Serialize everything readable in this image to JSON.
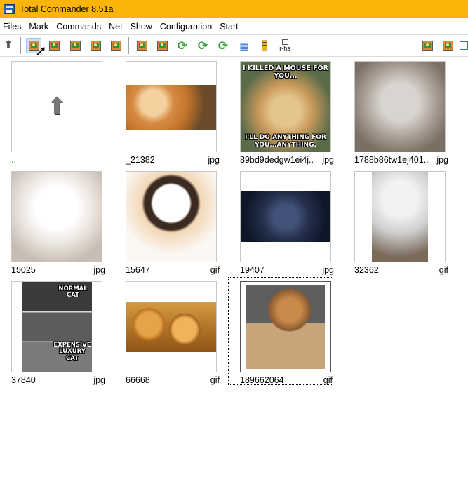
{
  "window": {
    "title": "Total Commander 8.51a"
  },
  "menu": [
    "Files",
    "Mark",
    "Commands",
    "Net",
    "Show",
    "Configuration",
    "Start"
  ],
  "toolbar": {
    "rhs_label": "r-hs"
  },
  "files": [
    {
      "name": "..",
      "ext": "",
      "kind": "parent"
    },
    {
      "name": "_21382",
      "ext": "jpg",
      "kind": "image"
    },
    {
      "name": "89bd9dedgw1ei4j..",
      "ext": "jpg",
      "kind": "meme",
      "top_text": "I KILLED A MOUSE FOR YOU...",
      "bottom_text": "I'LL DO ANYTHING FOR YOU...ANYTHING."
    },
    {
      "name": "1788b86tw1ej401..",
      "ext": "jpg",
      "kind": "image"
    },
    {
      "name": "15025",
      "ext": "jpg",
      "kind": "image"
    },
    {
      "name": "15647",
      "ext": "gif",
      "kind": "image"
    },
    {
      "name": "19407",
      "ext": "jpg",
      "kind": "image"
    },
    {
      "name": "32362",
      "ext": "gif",
      "kind": "image"
    },
    {
      "name": "37840",
      "ext": "jpg",
      "kind": "image",
      "labels": [
        "NORMAL CAT",
        "EXPENSIVE LUXURY CAT"
      ]
    },
    {
      "name": "66668",
      "ext": "gif",
      "kind": "image"
    },
    {
      "name": "189662064",
      "ext": "gif",
      "kind": "image",
      "focused": true
    }
  ],
  "colors": {
    "titlebar": "#fbb40a",
    "parent_dots": "#1a9f1a"
  }
}
